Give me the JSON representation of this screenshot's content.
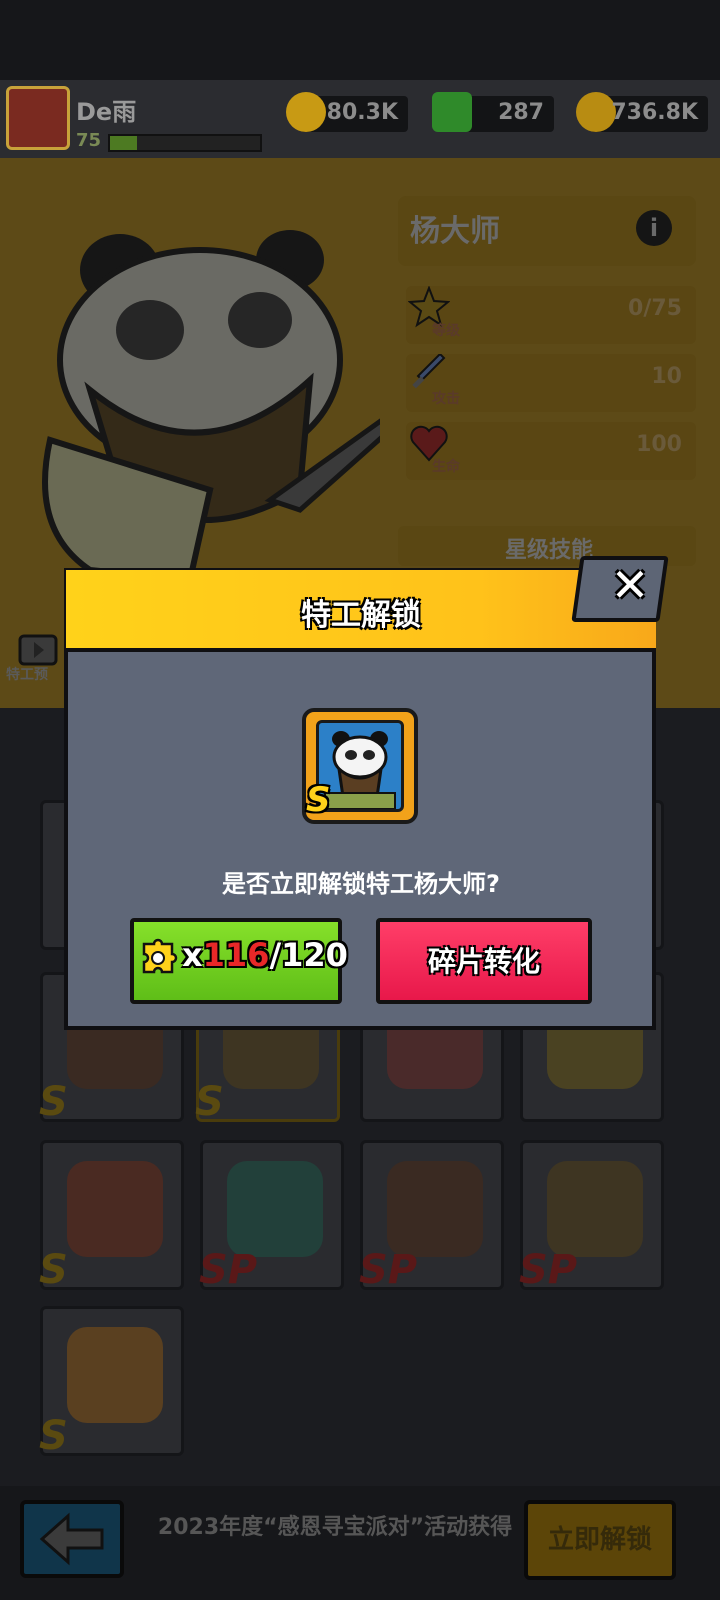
{
  "player": {
    "name": "De雨",
    "level": "75",
    "xp_fraction": 0.18
  },
  "resources": [
    {
      "name": "gold-drop",
      "value": "80.3K",
      "color": "#c89a14"
    },
    {
      "name": "green-gem",
      "value": "287",
      "color": "#2f8a2a"
    },
    {
      "name": "gold-coin",
      "value": "736.8K",
      "color": "#b88c12"
    }
  ],
  "hero": {
    "name": "杨大师",
    "info_icon": "i",
    "stats": [
      {
        "label": "等级",
        "value": "0/75",
        "icon": "star-icon"
      },
      {
        "label": "攻击",
        "value": "10",
        "icon": "sword-icon"
      },
      {
        "label": "生命",
        "value": "100",
        "icon": "heart-icon"
      }
    ],
    "skill_title": "星级技能",
    "preview_label": "特工预"
  },
  "grid": [
    {
      "rank": "S",
      "color": "#3a2a22"
    },
    {
      "rank": "S",
      "color": "#3e3522"
    },
    {
      "rank": "",
      "color": "#4a2a2a"
    },
    {
      "rank": "",
      "color": "#4a4222"
    },
    {
      "rank": "S",
      "color": "#4a2a22"
    },
    {
      "rank": "SP",
      "color": "#22403a"
    },
    {
      "rank": "SP",
      "color": "#3a2a22"
    },
    {
      "rank": "SP",
      "color": "#3e3522"
    },
    {
      "rank": "S",
      "color": "#5a4020"
    }
  ],
  "bottom": {
    "event_text": "2023年度“感恩寻宝派对”活动获得",
    "unlock_now": "立即解锁"
  },
  "modal": {
    "title": "特工解锁",
    "close": "✕",
    "portrait_rank": "S",
    "question": "是否立即解锁特工杨大师?",
    "fragment_prefix": "x",
    "fragment_have": "116",
    "fragment_need": "/120",
    "convert_label": "碎片转化"
  }
}
